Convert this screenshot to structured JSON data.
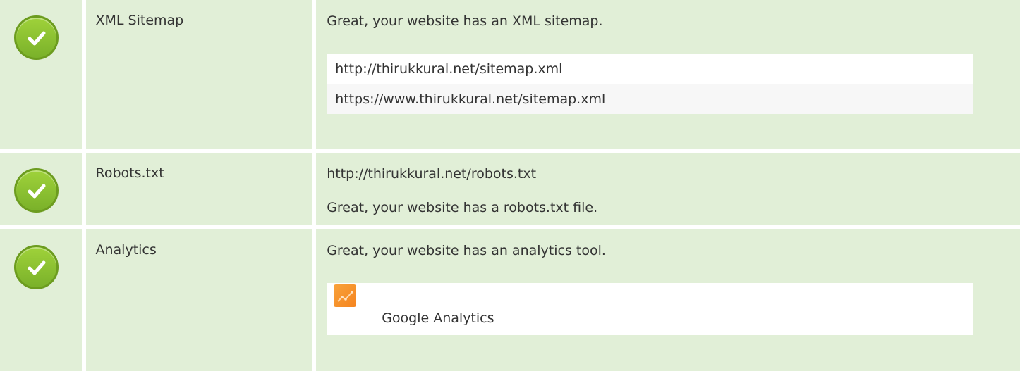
{
  "rows": [
    {
      "label": "XML Sitemap",
      "status_icon": "check-circle-icon",
      "message": "Great, your website has an XML sitemap.",
      "urls": [
        "http://thirukkural.net/sitemap.xml",
        "https://www.thirukkural.net/sitemap.xml"
      ]
    },
    {
      "label": "Robots.txt",
      "status_icon": "check-circle-icon",
      "url": "http://thirukkural.net/robots.txt",
      "message": "Great, your website has a robots.txt file."
    },
    {
      "label": "Analytics",
      "status_icon": "check-circle-icon",
      "message": "Great, your website has an analytics tool.",
      "tool": {
        "name": "Google Analytics",
        "icon": "google-analytics-icon"
      }
    }
  ],
  "colors": {
    "row_background": "#e1efd7",
    "check_green": "#8cc63f",
    "analytics_orange": "#f5841f"
  }
}
